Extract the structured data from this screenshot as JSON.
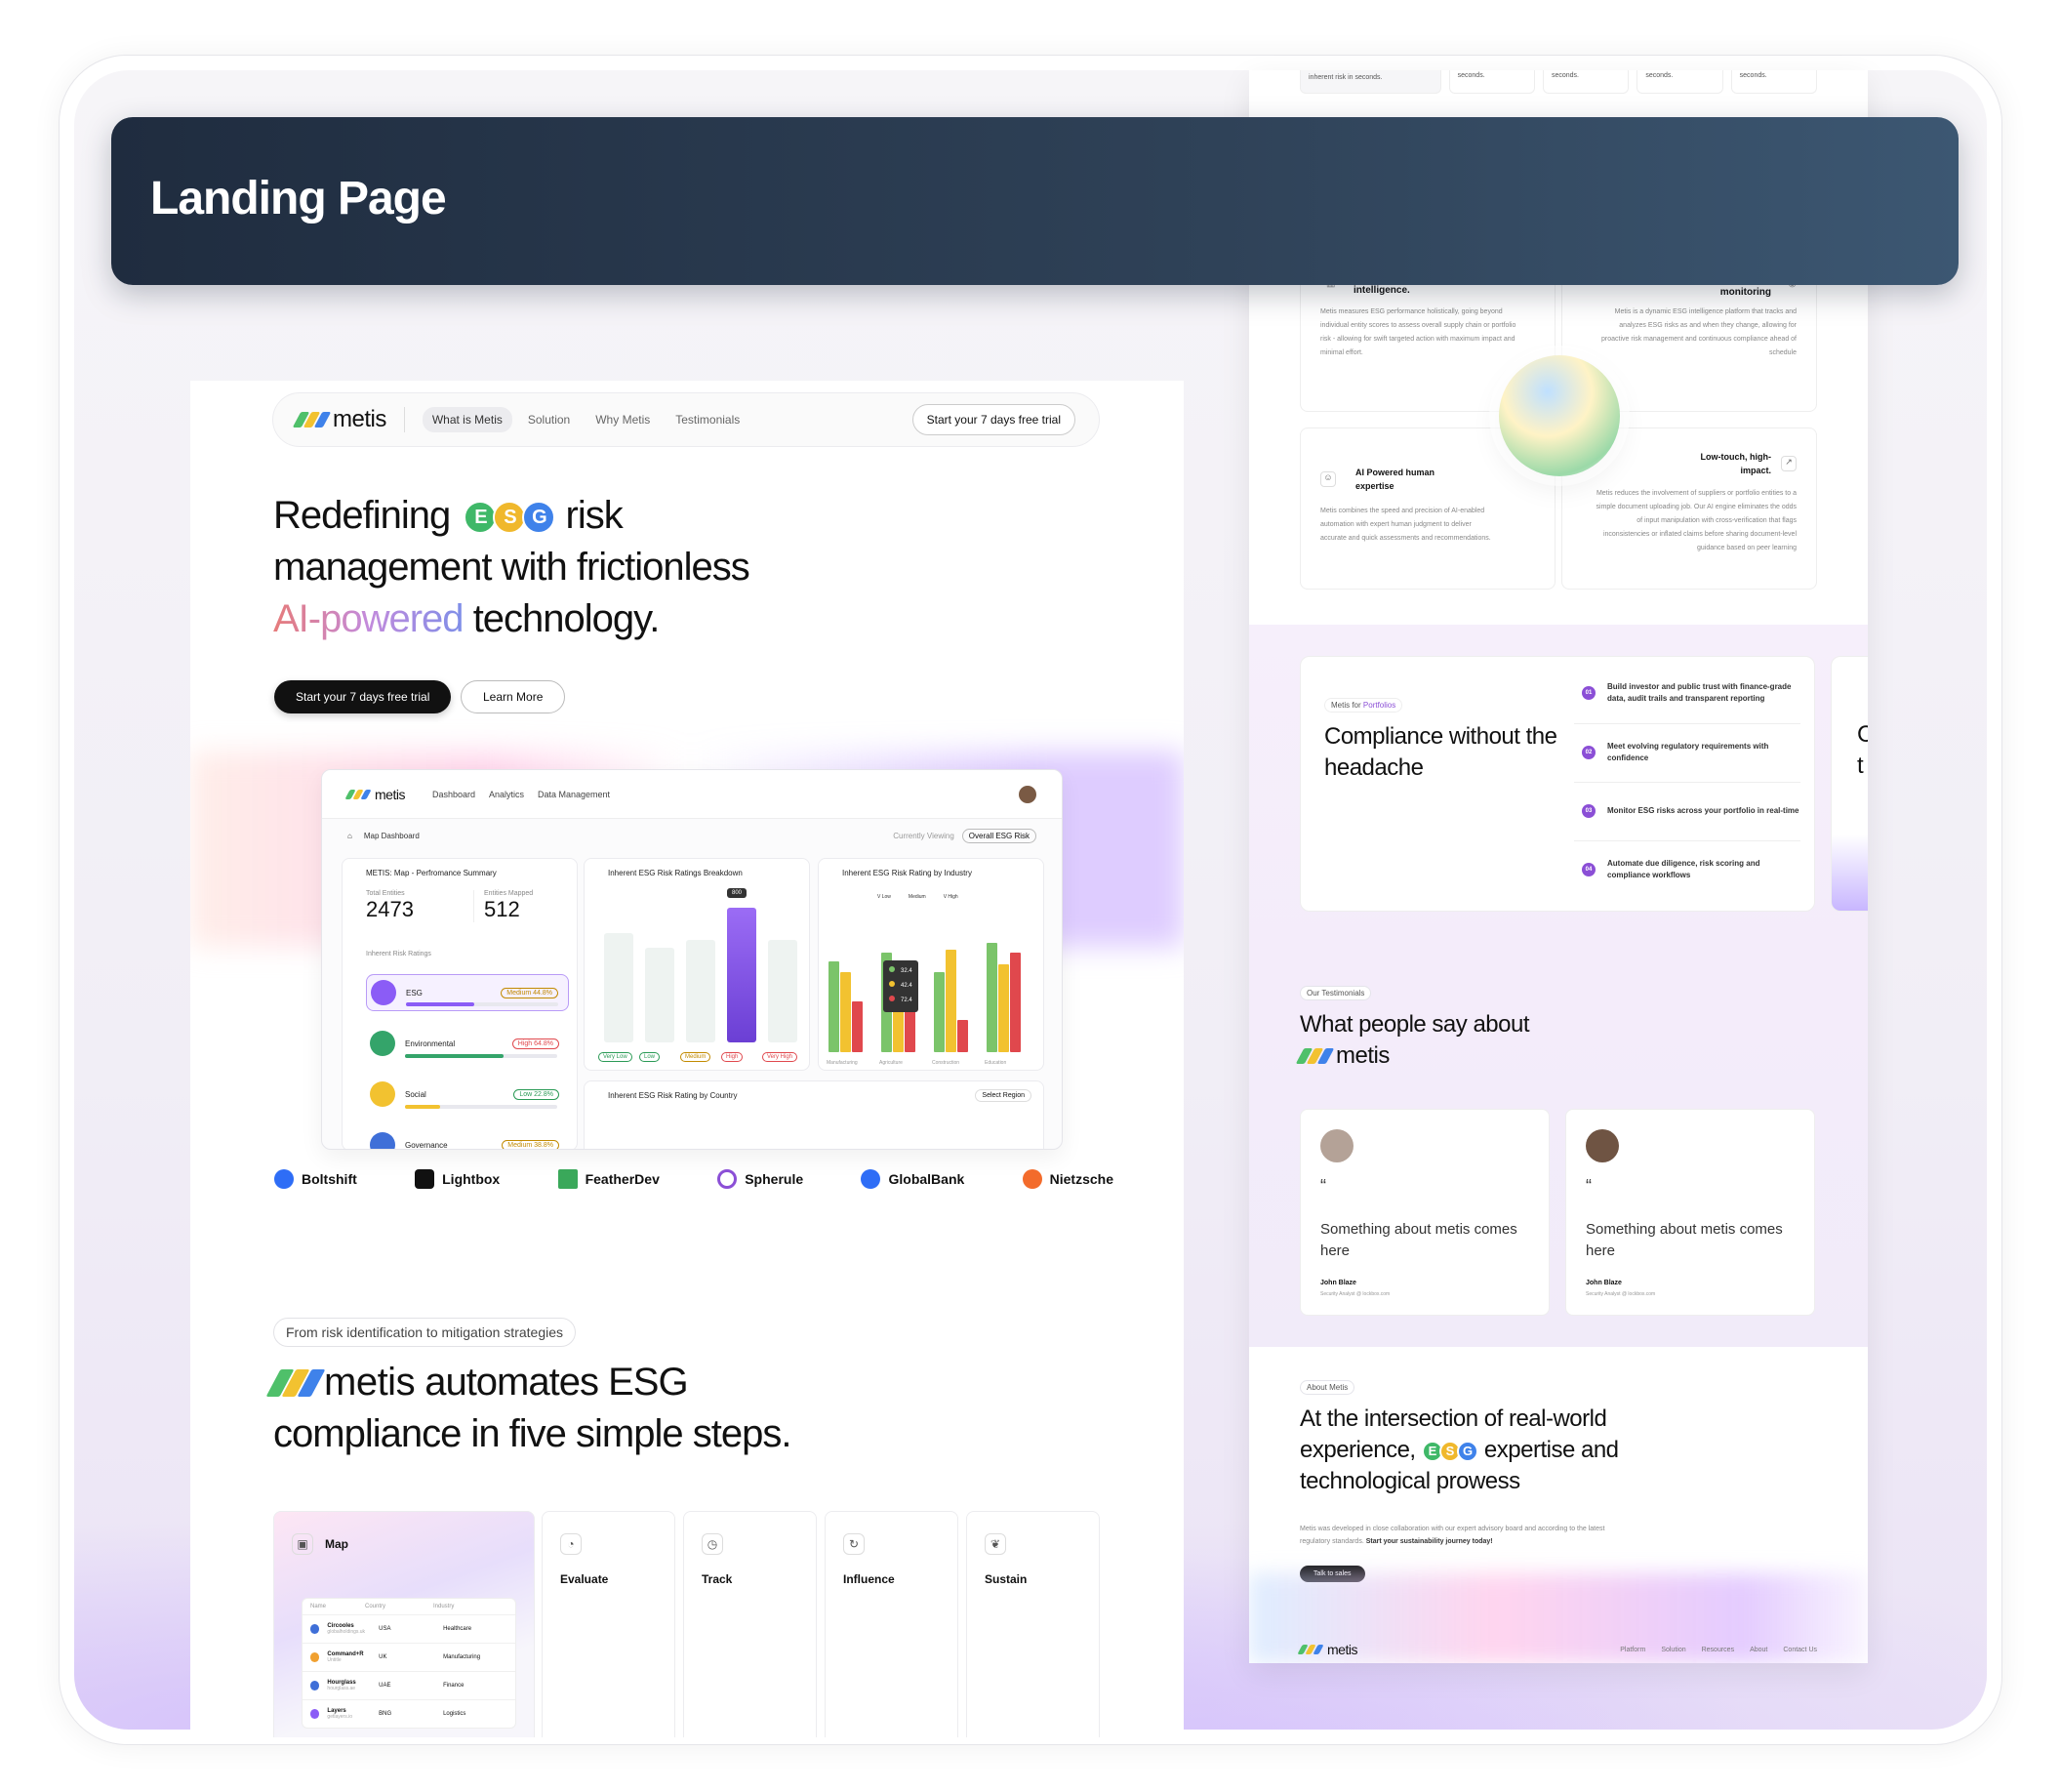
{
  "banner": {
    "title": "Landing Page"
  },
  "colors": {
    "accent": "#8b4fd6",
    "dark": "#111111",
    "banner_from": "#1f2c3f",
    "banner_to": "#3c5772"
  },
  "brand": {
    "name": "metis"
  },
  "nav": {
    "items": [
      "What is Metis",
      "Solution",
      "Why Metis",
      "Testimonials"
    ],
    "cta": "Start your 7 days free trial"
  },
  "hero": {
    "line1_a": "Redefining",
    "esg_letters": [
      "E",
      "S",
      "G"
    ],
    "line1_b": "risk",
    "line2": "management with frictionless",
    "highlight": "AI-powered",
    "line3_tail": "technology.",
    "primary_cta": "Start your 7 days free trial",
    "secondary_cta": "Learn More"
  },
  "dashboard": {
    "nav": [
      "Dashboard",
      "Analytics",
      "Data Management"
    ],
    "breadcrumb": "Map Dashboard",
    "currently_viewing": "Currently Viewing",
    "viewing_pill": "Overall ESG Risk",
    "summary_title": "METIS: Map - Perfromance Summary",
    "total_entities_label": "Total Entities",
    "total_entities": "2473",
    "entities_mapped_label": "Entities Mapped",
    "entities_mapped": "512",
    "ratings_label": "Inherent Risk Ratings",
    "ratings": [
      {
        "name": "ESG",
        "badge": "Medium 44.8%",
        "color": "#8b5cf6",
        "badge_color": "#c28a00",
        "level": 0.45
      },
      {
        "name": "Environmental",
        "badge": "High 64.8%",
        "color": "#34a46a",
        "badge_color": "#e0484d",
        "level": 0.65
      },
      {
        "name": "Social",
        "badge": "Low 22.8%",
        "color": "#f2c230",
        "badge_color": "#2a9a55",
        "level": 0.23
      },
      {
        "name": "Governance",
        "badge": "Medium 38.8%",
        "color": "#3f6fd8",
        "badge_color": "#c28a00",
        "level": 0.39
      }
    ],
    "breakdown_title": "Inherent ESG Risk Ratings Breakdown",
    "breakdown_tooltip": "800",
    "breakdown_labels": [
      "Very Low",
      "Low",
      "Medium",
      "High",
      "Very High"
    ],
    "industry_title": "Inherent ESG Risk Rating by Industry",
    "industry_legend": [
      "V Low",
      "Medium",
      "V High"
    ],
    "industry_tooltip": [
      "32.4",
      "42.4",
      "72.4"
    ],
    "industry_xlabels": [
      "Manufacturing",
      "Agriculture",
      "Construction",
      "Education"
    ],
    "country_title": "Inherent ESG Risk Rating by Country",
    "select_region": "Select Region"
  },
  "logos": [
    "Boltshift",
    "Lightbox",
    "FeatherDev",
    "Spherule",
    "GlobalBank",
    "Nietzsche"
  ],
  "steps_section": {
    "tag": "From risk identification to mitigation strategies",
    "heading_tail": "automates ESG",
    "heading_line2": "compliance in five simple steps.",
    "steps": [
      "Map",
      "Evaluate",
      "Track",
      "Influence",
      "Sustain"
    ],
    "table_headers": [
      "Name",
      "Country",
      "Industry"
    ],
    "table_rows": [
      {
        "name": "Circooles",
        "sub": "globalholdings.uk",
        "country": "USA",
        "industry": "Healthcare"
      },
      {
        "name": "Command+R",
        "sub": "Untitle",
        "country": "UK",
        "industry": "Manufacturing"
      },
      {
        "name": "Hourglass",
        "sub": "hourglass.ae",
        "country": "UAE",
        "industry": "Finance"
      },
      {
        "name": "Layers",
        "sub": "getlayers.io",
        "country": "BNG",
        "industry": "Logistics"
      }
    ]
  },
  "right": {
    "top_texts": [
      "inherent risk in seconds.",
      "seconds.",
      "seconds.",
      "seconds.",
      "seconds."
    ],
    "features": [
      {
        "title": "intelligence.",
        "desc": "Metis measures ESG performance holistically, going beyond individual entity scores to assess overall supply chain or portfolio risk - allowing for swift targeted action with maximum impact and minimal effort."
      },
      {
        "title": "monitoring",
        "desc": "Metis is a dynamic ESG intelligence platform that tracks and analyzes ESG risks as and when they change, allowing for proactive risk management and continuous compliance ahead of schedule"
      },
      {
        "title": "AI Powered human expertise",
        "desc": "Metis combines the speed and precision of AI-enabled automation with expert human judgment to deliver accurate and quick assessments and recommendations."
      },
      {
        "title": "Low-touch, high-impact.",
        "desc": "Metis reduces the involvement of suppliers or portfolio entities to a simple document uploading job. Our AI engine eliminates the odds of input manipulation with cross-verification that flags inconsistencies or inflated claims before sharing document-level guidance based on peer learning"
      }
    ],
    "compliance": {
      "label_a": "Metis for",
      "label_b": "Portfolios",
      "heading": "Compliance without the headache",
      "items": [
        {
          "n": "01",
          "text": "Build investor and public trust with finance-grade data, audit trails and transparent reporting"
        },
        {
          "n": "02",
          "text": "Meet evolving regulatory requirements with confidence"
        },
        {
          "n": "03",
          "text": "Monitor ESG risks across your portfolio in real-time"
        },
        {
          "n": "04",
          "text": "Automate due diligence, risk scoring and compliance workflows"
        }
      ],
      "peek_letters": [
        "C",
        "t"
      ]
    },
    "testimonials": {
      "tag": "Our Testimonials",
      "heading": "What people say about",
      "cards": [
        {
          "quote_mark": "“",
          "text": "Something about metis comes here",
          "author": "John Blaze",
          "role": "Security Analyst @ lockbox.com"
        },
        {
          "quote_mark": "“",
          "text": "Something about metis comes here",
          "author": "John Blaze",
          "role": "Security Analyst @ lockbox.com"
        }
      ]
    },
    "about": {
      "tag": "About Metis",
      "line1": "At the intersection of real-world",
      "line2_a": "experience,",
      "line2_b": "expertise and",
      "line3": "technological prowess",
      "para": "Metis was developed in close collaboration with our expert advisory board and according to the latest regulatory standards.",
      "para_bold": "Start your sustainability journey today!",
      "cta": "Talk to sales"
    },
    "footer_links": [
      "Platform",
      "Solution",
      "Resources",
      "About",
      "Contact Us"
    ]
  }
}
